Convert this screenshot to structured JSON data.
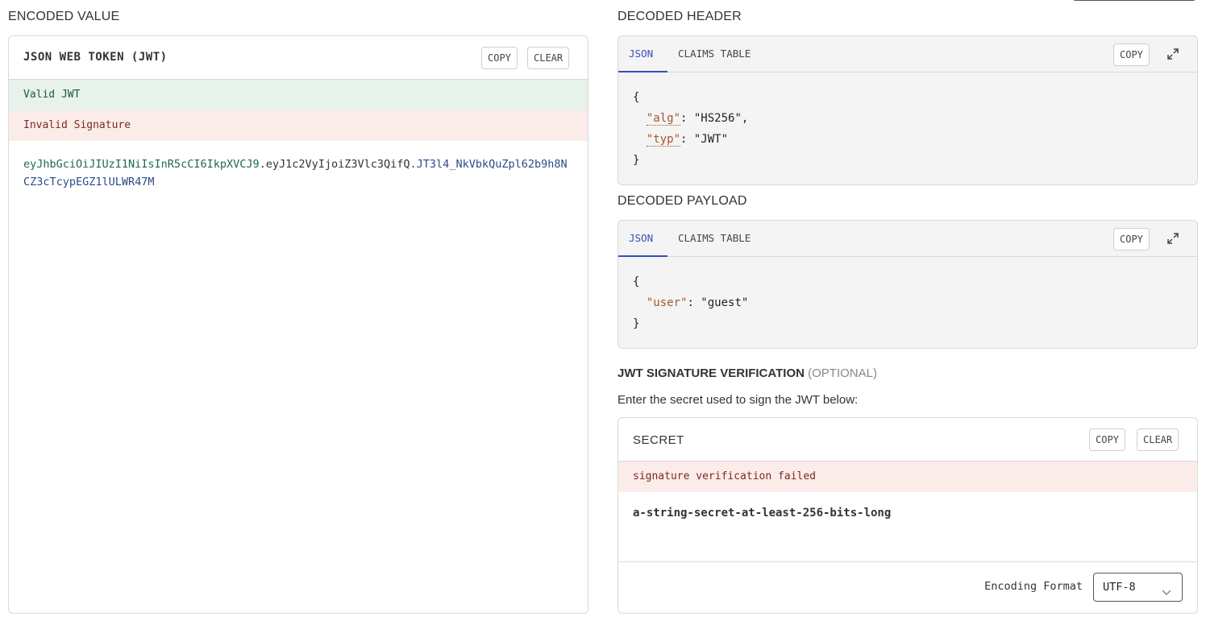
{
  "encoded": {
    "section_title": "ENCODED VALUE",
    "panel_title": "JSON WEB TOKEN (JWT)",
    "copy_label": "COPY",
    "clear_label": "CLEAR",
    "status_valid": "Valid JWT",
    "status_invalid": "Invalid Signature",
    "token_header": "eyJhbGciOiJIUzI1NiIsInR5cCI6IkpXVCJ9",
    "token_payload": ".eyJ1c2VyIjoiZ3Vlc3QifQ",
    "token_signature": ".JT3l4_NkVbkQuZpl62b9h8NCZ3cTcypEGZ1lULWR47M"
  },
  "decoded_header": {
    "section_title": "DECODED HEADER",
    "tab_json": "JSON",
    "tab_claims": "CLAIMS TABLE",
    "copy_label": "COPY",
    "line1": "{",
    "alg_key": "\"alg\"",
    "alg_sep": ": ",
    "alg_value": "\"HS256\",",
    "typ_key": "\"typ\"",
    "typ_sep": ": ",
    "typ_value": "\"JWT\"",
    "line_end": "}"
  },
  "decoded_payload": {
    "section_title": "DECODED PAYLOAD",
    "tab_json": "JSON",
    "tab_claims": "CLAIMS TABLE",
    "copy_label": "COPY",
    "line1": "{",
    "user_key": "\"user\"",
    "user_sep": ": ",
    "user_value": "\"guest\"",
    "line_end": "}"
  },
  "verification": {
    "title": "JWT SIGNATURE VERIFICATION",
    "optional": "(OPTIONAL)",
    "instruction": "Enter the secret used to sign the JWT below:",
    "panel_title": "SECRET",
    "copy_label": "COPY",
    "clear_label": "CLEAR",
    "error": "signature verification failed",
    "secret_value": "a-string-secret-at-least-256-bits-long",
    "encoding_label": "Encoding Format",
    "encoding_value": "UTF-8"
  },
  "colors": {
    "accent": "#3b4db8",
    "valid_bg": "#e6f2ea",
    "invalid_bg": "#fbecea",
    "json_key": "#a8542a"
  },
  "icons": [
    "expand-icon",
    "chevron-down-icon"
  ]
}
